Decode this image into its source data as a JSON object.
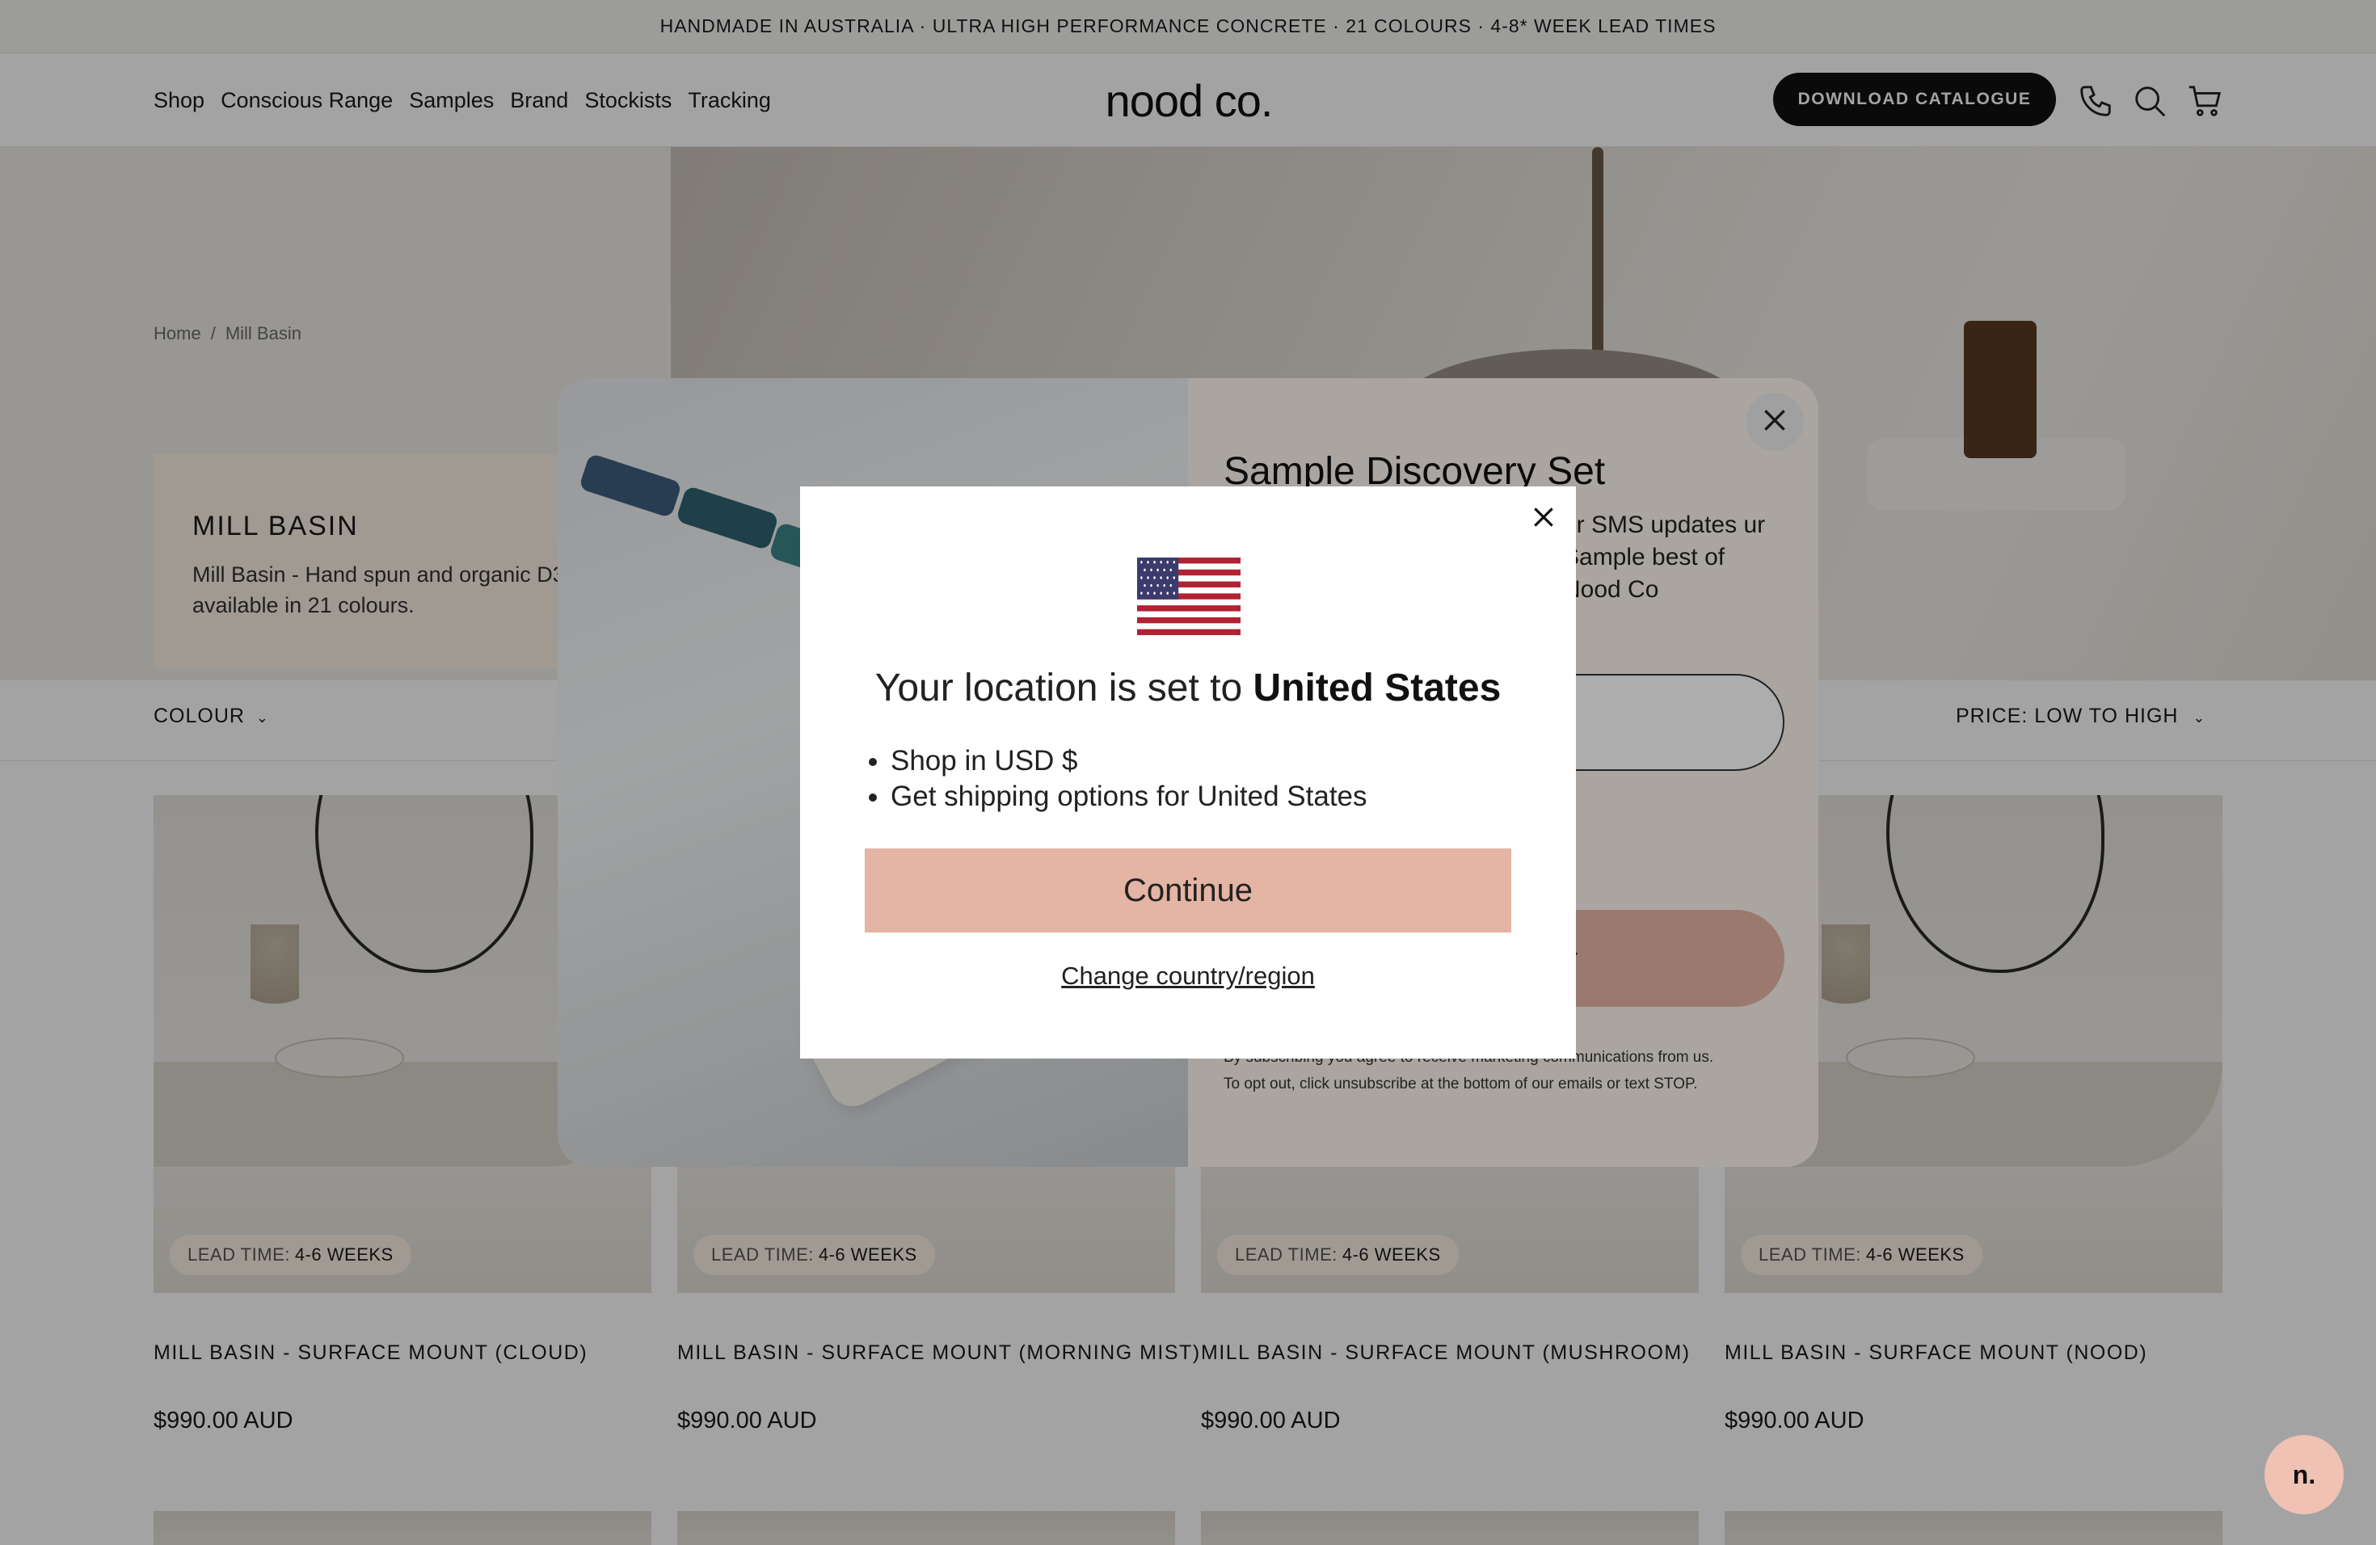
{
  "announcement": "HANDMADE IN AUSTRALIA · ULTRA HIGH PERFORMANCE CONCRETE · 21 COLOURS · 4-8* WEEK LEAD TIMES",
  "header": {
    "nav": [
      "Shop",
      "Conscious Range",
      "Samples",
      "Brand",
      "Stockists",
      "Tracking"
    ],
    "logo": "nood co.",
    "download_button": "DOWNLOAD CATALOGUE",
    "icons": [
      "phone-icon",
      "search-icon",
      "cart-icon"
    ]
  },
  "breadcrumb": [
    "Home",
    "/",
    "Mill Basin"
  ],
  "collection": {
    "title": "MILL BASIN",
    "description": "Mill Basin - Hand spun and organic D380mm available in 21 colours."
  },
  "filters": {
    "left": "COLOUR",
    "sort": "PRICE: LOW TO HIGH"
  },
  "products": [
    {
      "lead_label": "LEAD TIME:",
      "lead_value": "4-6 WEEKS",
      "name": "MILL BASIN - SURFACE MOUNT (CLOUD)",
      "price": "$990.00 AUD"
    },
    {
      "lead_label": "LEAD TIME:",
      "lead_value": "4-6 WEEKS",
      "name": "MILL BASIN - SURFACE MOUNT (MORNING MIST)",
      "price": "$990.00 AUD"
    },
    {
      "lead_label": "LEAD TIME:",
      "lead_value": "4-6 WEEKS",
      "name": "MILL BASIN - SURFACE MOUNT (MUSHROOM)",
      "price": "$990.00 AUD"
    },
    {
      "lead_label": "LEAD TIME:",
      "lead_value": "4-6 WEEKS",
      "name": "MILL BASIN - SURFACE MOUNT (NOOD)",
      "price": "$990.00 AUD"
    }
  ],
  "chat_button": "n.",
  "signup_popup": {
    "title": "Sample Discovery Set",
    "text": "or SMS updates ur Sample best of Nood Co",
    "submit_fragment": "er",
    "legal_line1": "By subscribing you agree to receive marketing communications from us.",
    "legal_line2": "To opt out, click unsubscribe at the bottom of our emails or text STOP."
  },
  "location_modal": {
    "title_prefix": "Your location is set to",
    "country": "United States",
    "bullets": [
      "Shop in USD $",
      "Get shipping options for United States"
    ],
    "continue": "Continue",
    "change": "Change country/region"
  },
  "colors": {
    "accent": "#e4b4a4",
    "announcement_bg": "#f4f4f1",
    "card_bg": "#fbf1e4",
    "dark": "#111111"
  }
}
